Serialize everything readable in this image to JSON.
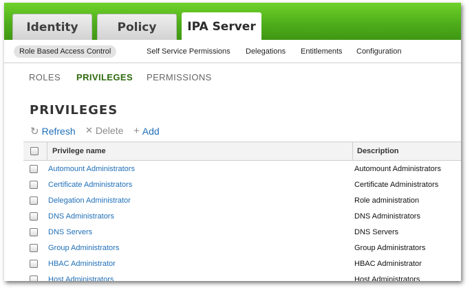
{
  "tabs": [
    {
      "label": "Identity",
      "active": false
    },
    {
      "label": "Policy",
      "active": false
    },
    {
      "label": "IPA Server",
      "active": true
    }
  ],
  "subnav": [
    {
      "label": "Role Based Access Control",
      "selected": true
    },
    {
      "label": "Self Service Permissions",
      "selected": false
    },
    {
      "label": "Delegations",
      "selected": false
    },
    {
      "label": "Entitlements",
      "selected": false
    },
    {
      "label": "Configuration",
      "selected": false
    }
  ],
  "l3nav": [
    {
      "label": "ROLES",
      "selected": false
    },
    {
      "label": "PRIVILEGES",
      "selected": true
    },
    {
      "label": "PERMISSIONS",
      "selected": false
    }
  ],
  "page_title": "PRIVILEGES",
  "actions": {
    "refresh": {
      "label": "Refresh",
      "icon": "refresh-icon"
    },
    "delete": {
      "label": "Delete",
      "icon": "x-icon"
    },
    "add": {
      "label": "Add",
      "icon": "plus-icon"
    }
  },
  "table": {
    "columns": [
      "Privilege name",
      "Description"
    ],
    "rows": [
      {
        "name": "Automount Administrators",
        "description": "Automount Administrators"
      },
      {
        "name": "Certificate Administrators",
        "description": "Certificate Administrators"
      },
      {
        "name": "Delegation Administrator",
        "description": "Role administration"
      },
      {
        "name": "DNS Administrators",
        "description": "DNS Administrators"
      },
      {
        "name": "DNS Servers",
        "description": "DNS Servers"
      },
      {
        "name": "Group Administrators",
        "description": "Group Administrators"
      },
      {
        "name": "HBAC Administrator",
        "description": "HBAC Administrator"
      },
      {
        "name": "Host Administrators",
        "description": "Host Administrators"
      }
    ]
  },
  "colors": {
    "banner": "#4fae1b",
    "link": "#1f6fb8",
    "selected_nav": "#2f6a0e"
  }
}
